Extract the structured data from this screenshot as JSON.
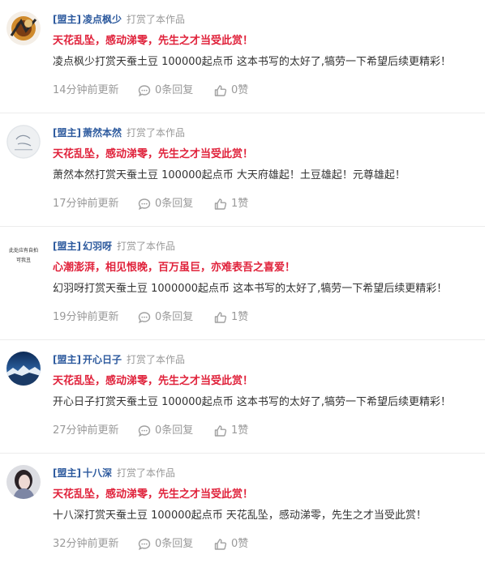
{
  "comments": [
    {
      "role": "[盟主]",
      "name": "凌点枫少",
      "action": "打赏了本作品",
      "headline": "天花乱坠，感动涕零，先生之才当受此赏！",
      "body": "凌点枫少打赏天蚕土豆 100000起点币 这本书写的太好了,犒劳一下希望后续更精彩！",
      "time": "14分钟前更新",
      "replies": "0条回复",
      "likes": "0赞"
    },
    {
      "role": "[盟主]",
      "name": "萧然本然",
      "action": "打赏了本作品",
      "headline": "天花乱坠，感动涕零，先生之才当受此赏！",
      "body": "萧然本然打赏天蚕土豆 100000起点币 大天府雄起！土豆雄起！元尊雄起！",
      "time": "17分钟前更新",
      "replies": "0条回复",
      "likes": "1赞"
    },
    {
      "role": "[盟主]",
      "name": "幻羽呀",
      "action": "打赏了本作品",
      "headline": "心潮澎湃，相见恨晚，百万虽巨，亦难表吾之喜爱！",
      "body": "幻羽呀打赏天蚕土豆 1000000起点币 这本书写的太好了,犒劳一下希望后续更精彩！",
      "time": "19分钟前更新",
      "replies": "0条回复",
      "likes": "1赞",
      "avatar_text": [
        "此处应有自拍",
        "可我丑"
      ]
    },
    {
      "role": "[盟主]",
      "name": "开心日子",
      "action": "打赏了本作品",
      "headline": "天花乱坠，感动涕零，先生之才当受此赏！",
      "body": "开心日子打赏天蚕土豆 100000起点币 这本书写的太好了,犒劳一下希望后续更精彩！",
      "time": "27分钟前更新",
      "replies": "0条回复",
      "likes": "1赞"
    },
    {
      "role": "[盟主]",
      "name": "十八深",
      "action": "打赏了本作品",
      "headline": "天花乱坠，感动涕零，先生之才当受此赏！",
      "body": "十八深打赏天蚕土豆 100000起点币 天花乱坠，感动涕零，先生之才当受此赏！",
      "time": "32分钟前更新",
      "replies": "0条回复",
      "likes": "0赞"
    }
  ],
  "colors": {
    "headline": "#e0223b",
    "username": "#2d5a9e",
    "muted": "#9a9a9a"
  }
}
